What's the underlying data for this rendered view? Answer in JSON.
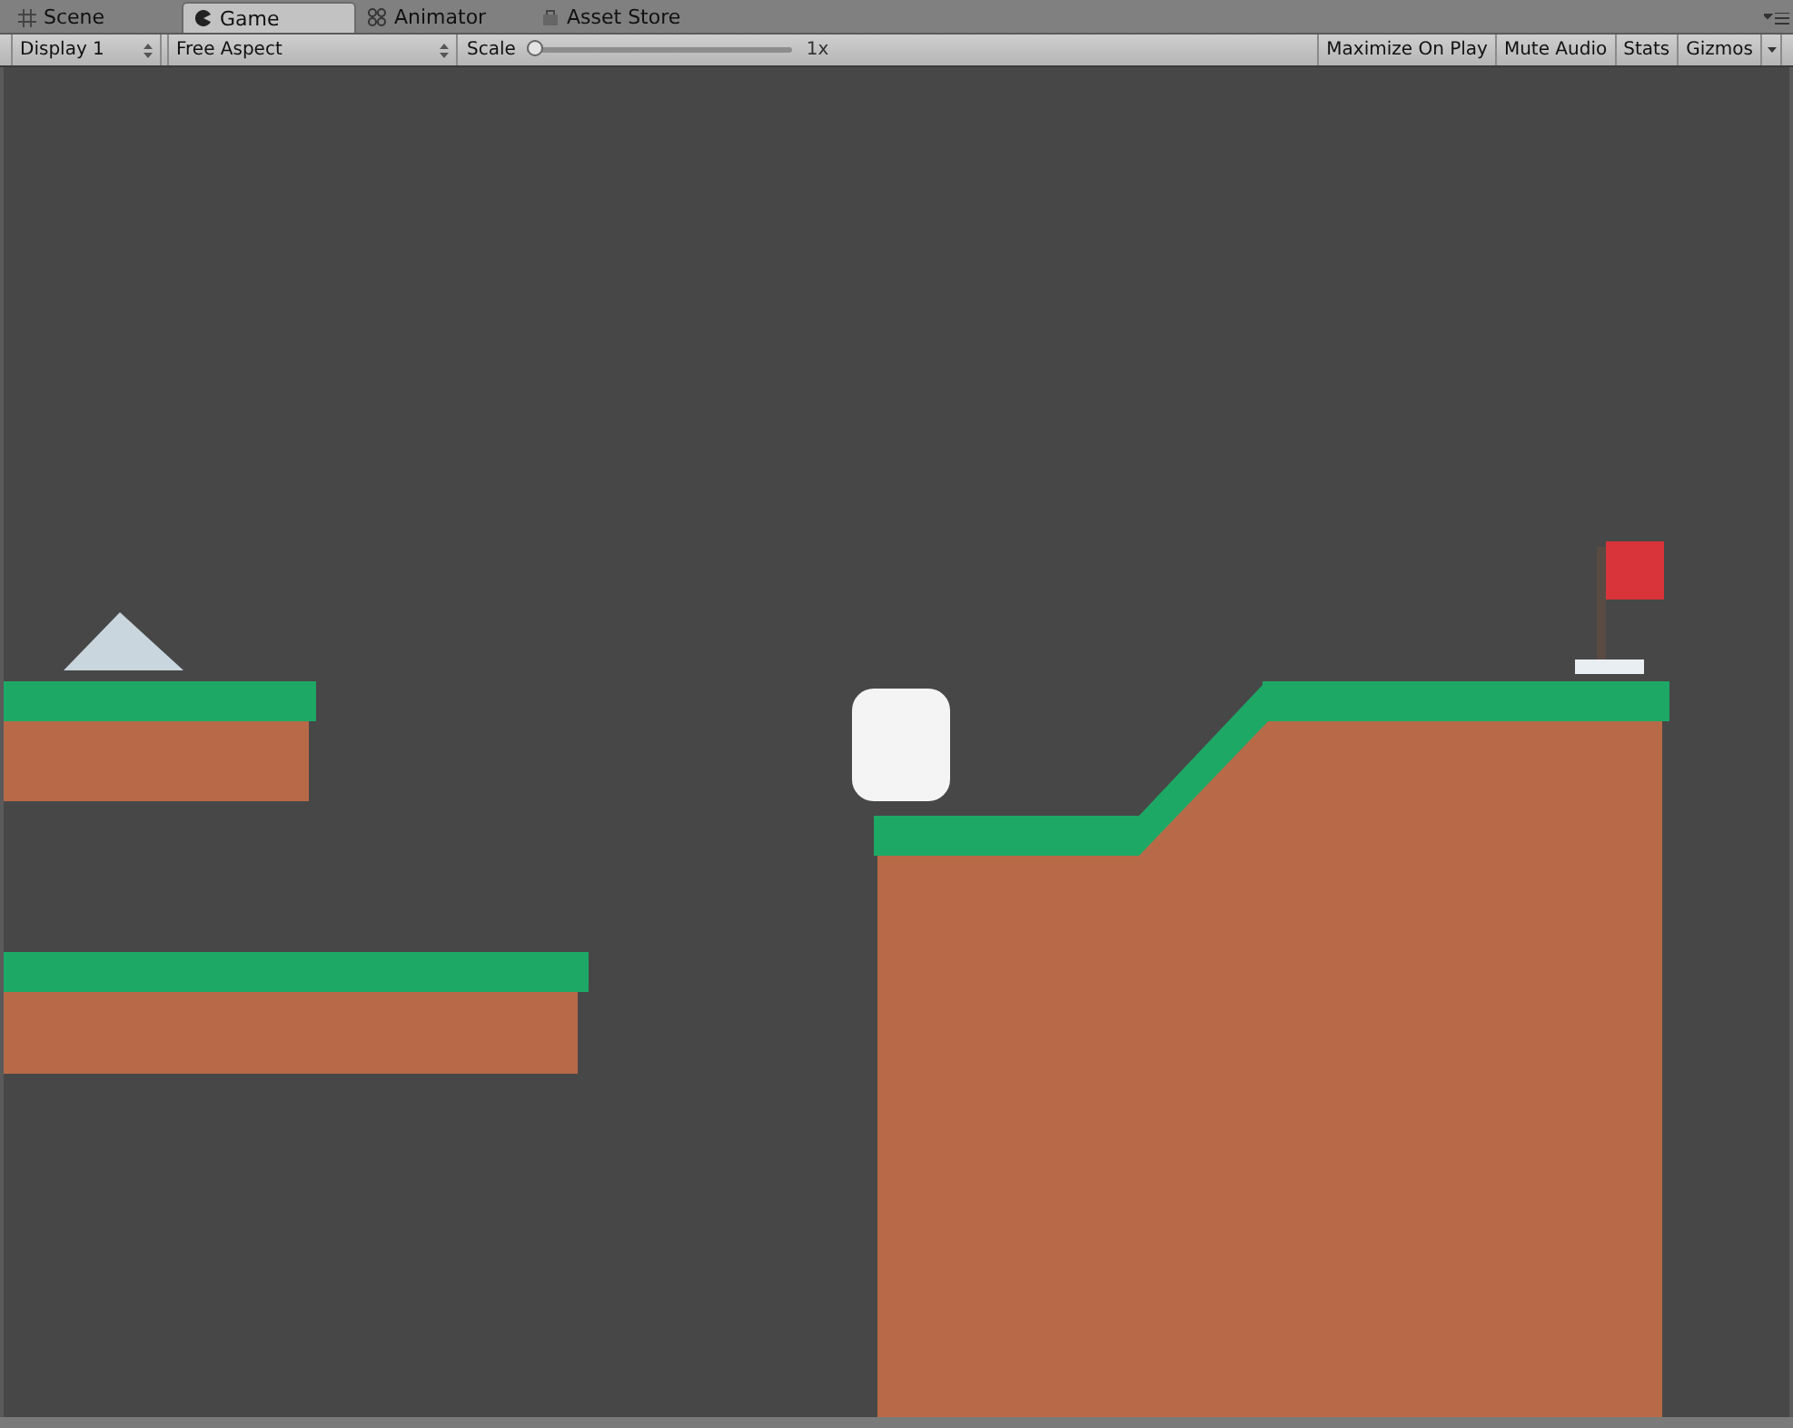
{
  "tabs": [
    {
      "label": "Scene",
      "kind": "grid",
      "selected": false
    },
    {
      "label": "Game",
      "kind": "pacman",
      "selected": true
    },
    {
      "label": "Animator",
      "kind": "nodes",
      "selected": false
    },
    {
      "label": "Asset Store",
      "kind": "bag",
      "selected": false
    }
  ],
  "toolbar": {
    "display": "Display 1",
    "aspect": "Free Aspect",
    "scale": {
      "label": "Scale",
      "level": 0,
      "reading": "1x"
    },
    "buttons": [
      "Maximize On Play",
      "Mute Audio",
      "Stats"
    ],
    "gizmos": "Gizmos"
  }
}
